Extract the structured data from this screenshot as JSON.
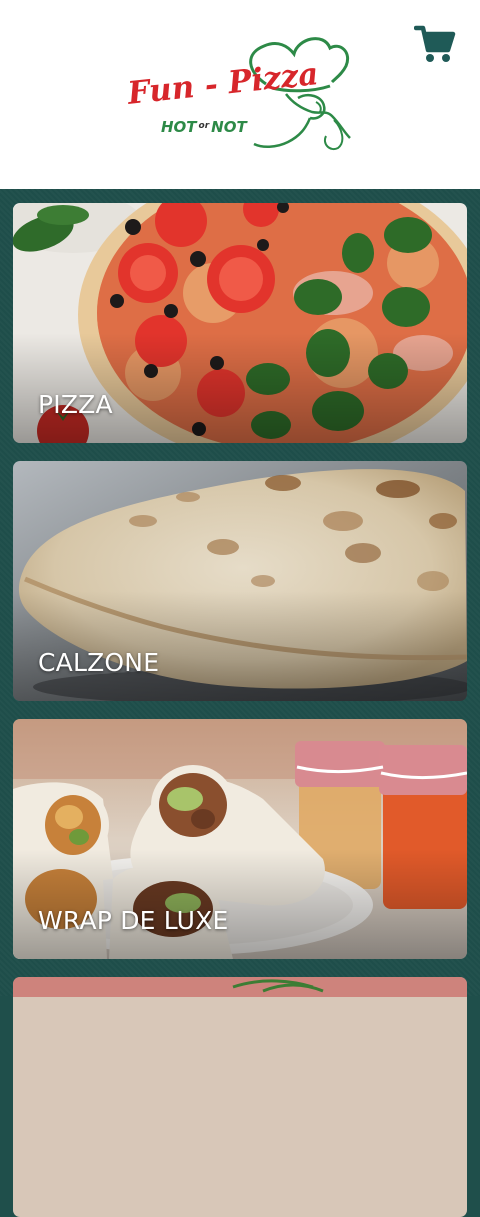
{
  "header": {
    "logo": {
      "name": "Fun - Pizza",
      "tagline_hot": "HOT",
      "tagline_or": "or",
      "tagline_not": "NOT"
    },
    "cart_icon": "shopping-cart-icon"
  },
  "colors": {
    "background": "#1f4f4b",
    "header_bg": "#ffffff",
    "cart": "#1f5a57",
    "logo_red": "#d7262b",
    "logo_green": "#2d8a47"
  },
  "categories": [
    {
      "label": "PIZZA"
    },
    {
      "label": "CALZONE"
    },
    {
      "label": "WRAP DE LUXE"
    },
    {
      "label": ""
    }
  ]
}
